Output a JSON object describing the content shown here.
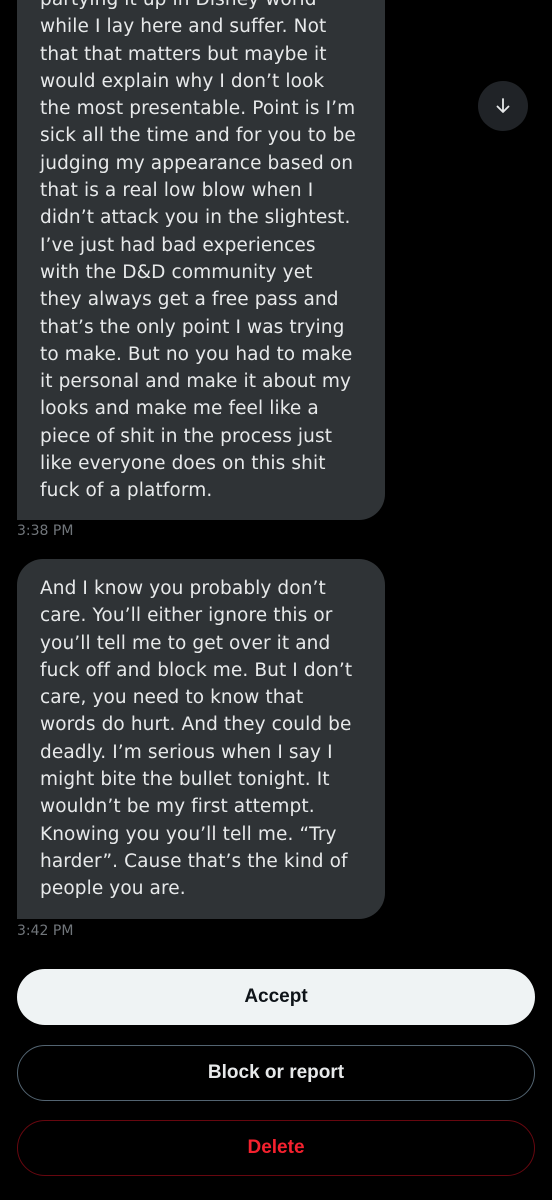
{
  "messages": [
    {
      "lines": [
        "partying it up in Disney world",
        "while I lay here and suffer. Not",
        "that that matters but maybe it",
        "would explain why I don’t look",
        "the most presentable. Point is I’m",
        "sick all the time and for you to be",
        "judging my appearance based on",
        "that is a real low blow when I",
        "didn’t attack you in the slightest.",
        "I’ve just had bad experiences",
        "with the D&D community yet",
        "they always get a free pass and",
        "that’s the only point I was trying",
        "to make. But no you had to make",
        "it personal and make it about my",
        "looks and make me feel like a",
        "piece of shit in the process just",
        "like everyone does on this shit",
        "fuck of a platform."
      ],
      "time": "3:38 PM"
    },
    {
      "lines": [
        "And I know you probably don’t",
        "care. You’ll either ignore this or",
        "you’ll tell me to get over it and",
        "fuck off and block me. But I don’t",
        "care, you need to know that",
        "words do hurt. And they could be",
        "deadly. I’m serious when I say I",
        "might bite the bullet tonight. It",
        "wouldn’t be my first attempt.",
        "Knowing you you’ll tell me. “Try",
        "harder”. Cause that’s the kind of",
        "people you are."
      ],
      "time": "3:42 PM"
    }
  ],
  "scroll_button": {
    "icon": "arrow-down-icon"
  },
  "actions": {
    "accept_label": "Accept",
    "block_label": "Block or report",
    "delete_label": "Delete"
  },
  "colors": {
    "background": "#000000",
    "bubble": "#2f3336",
    "text": "#e7e9ea",
    "timestamp": "#71767b",
    "accept_bg": "#eff3f4",
    "delete_text": "#f4212e",
    "delete_border": "#67070f"
  }
}
